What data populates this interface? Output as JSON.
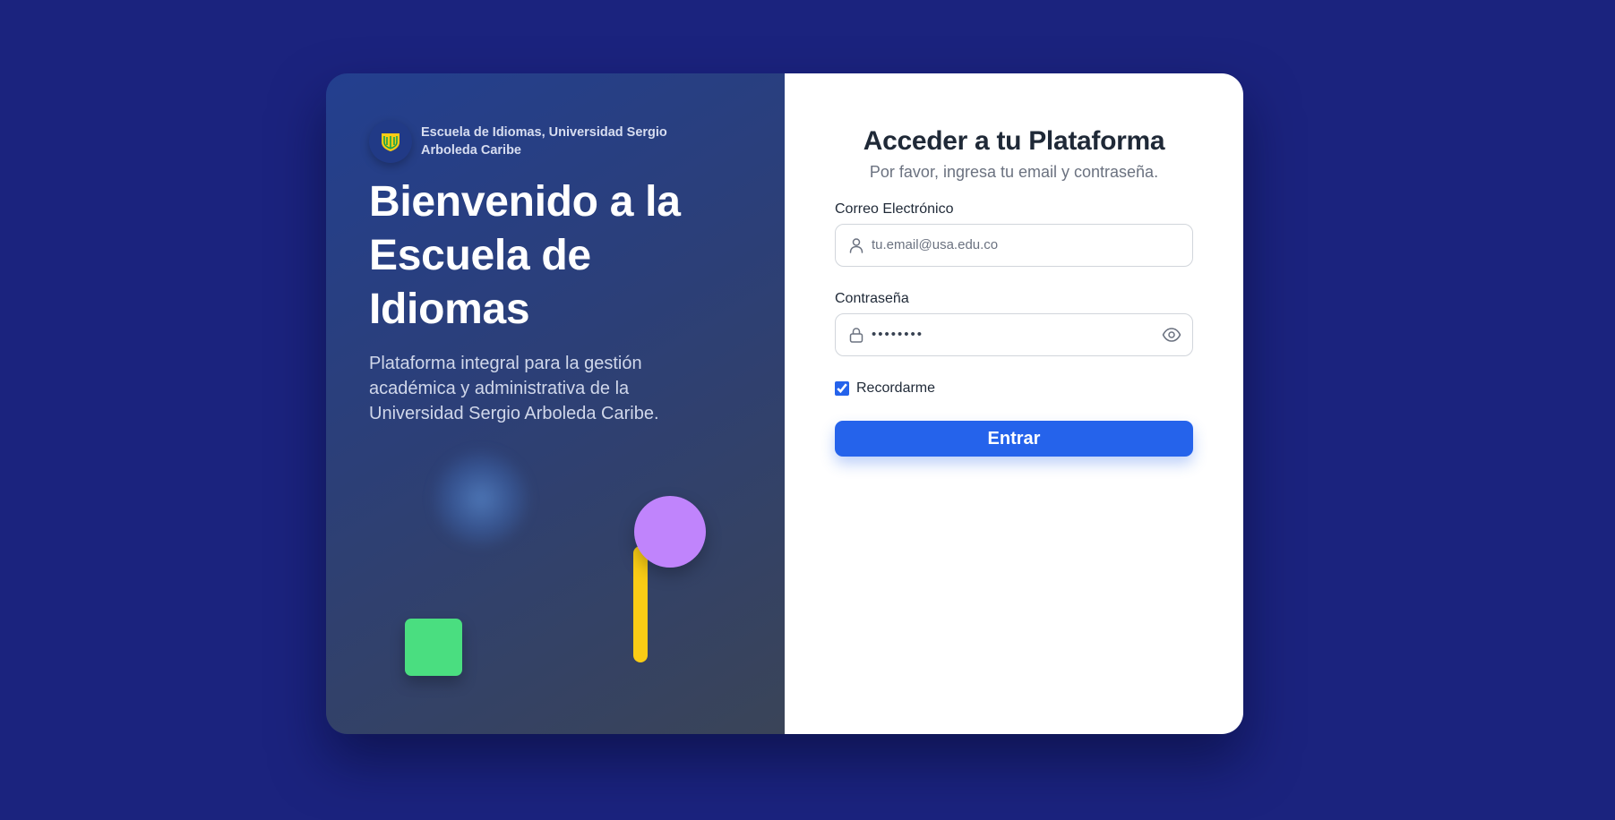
{
  "brand": {
    "name": "Escuela de Idiomas, Universidad Sergio Arboleda Caribe",
    "logo_icon": "university-shield-icon"
  },
  "hero": {
    "title": "Bienvenido a la Escuela de Idiomas",
    "subtitle": "Plataforma integral para la gestión académica y administrativa de la Universidad Sergio Arboleda Caribe."
  },
  "form": {
    "title": "Acceder a tu Plataforma",
    "subtitle": "Por favor, ingresa tu email y contraseña.",
    "email": {
      "label": "Correo Electrónico",
      "placeholder": "tu.email@usa.edu.co",
      "value": "",
      "icon": "user-icon"
    },
    "password": {
      "label": "Contraseña",
      "value": "12345678",
      "icon": "lock-icon",
      "toggle_icon": "eye-icon"
    },
    "remember": {
      "label": "Recordarme",
      "checked": true
    },
    "submit_label": "Entrar"
  },
  "colors": {
    "background": "#1b237e",
    "accent": "#2563eb",
    "shape_green": "#4ade80",
    "shape_yellow": "#facc15",
    "shape_purple": "#c084fc"
  }
}
